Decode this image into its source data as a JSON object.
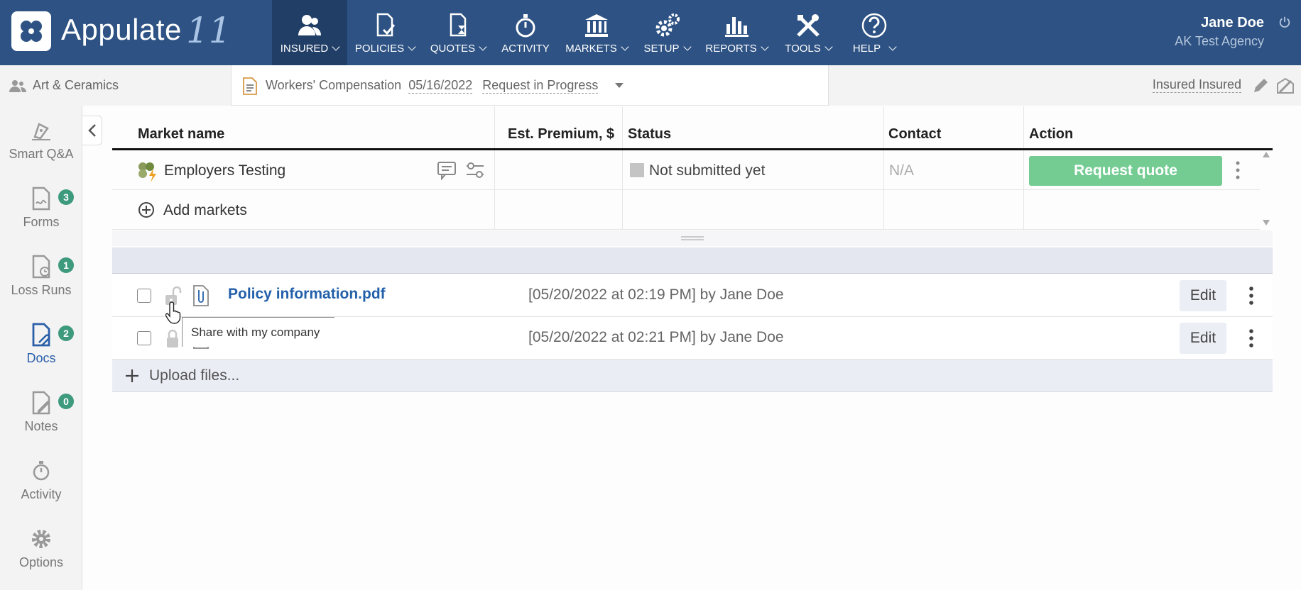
{
  "app": {
    "brand": "Appulate",
    "version_glyph": "11"
  },
  "nav": [
    {
      "label": "INSURED",
      "icon": "users-icon",
      "dropdown": true,
      "active": true
    },
    {
      "label": "POLICIES",
      "icon": "policy-check-icon",
      "dropdown": true
    },
    {
      "label": "QUOTES",
      "icon": "quote-hourglass-icon",
      "dropdown": true
    },
    {
      "label": "ACTIVITY",
      "icon": "stopwatch-icon",
      "dropdown": false
    },
    {
      "label": "MARKETS",
      "icon": "bank-icon",
      "dropdown": true
    },
    {
      "label": "SETUP",
      "icon": "gears-icon",
      "dropdown": true
    },
    {
      "label": "REPORTS",
      "icon": "bar-chart-icon",
      "dropdown": true
    },
    {
      "label": "TOOLS",
      "icon": "tools-icon",
      "dropdown": true
    },
    {
      "label": "HELP",
      "icon": "help-icon",
      "dropdown": true
    }
  ],
  "user": {
    "name": "Jane Doe",
    "agency": "AK Test Agency"
  },
  "subheader": {
    "insured": "Art & Ceramics",
    "policy_type": "Workers' Compensation",
    "date": "05/16/2022",
    "status": "Request in Progress",
    "right_label": "Insured Insured"
  },
  "sidebar": [
    {
      "label": "Smart Q&A",
      "icon": "pen-nib-icon",
      "badge": null
    },
    {
      "label": "Forms",
      "icon": "forms-icon",
      "badge": "3"
    },
    {
      "label": "Loss Runs",
      "icon": "loss-runs-icon",
      "badge": "1"
    },
    {
      "label": "Docs",
      "icon": "docs-icon",
      "badge": "2",
      "active": true
    },
    {
      "label": "Notes",
      "icon": "notes-icon",
      "badge": "0"
    },
    {
      "label": "Activity",
      "icon": "stopwatch-icon",
      "badge": null
    },
    {
      "label": "Options",
      "icon": "gear-icon",
      "badge": null
    }
  ],
  "markets": {
    "columns": [
      "Market name",
      "Est. Premium, $",
      "Status",
      "Contact",
      "Action"
    ],
    "rows": [
      {
        "name": "Employers Testing",
        "premium": "",
        "status": "Not submitted yet",
        "contact": "N/A",
        "action": "Request quote"
      }
    ],
    "add_label": "Add markets"
  },
  "docs": [
    {
      "name": "Policy information.pdf",
      "meta": "[05/20/2022 at 02:19 PM] by Jane Doe",
      "edit": "Edit"
    },
    {
      "name": "",
      "meta": "[05/20/2022 at 02:21 PM] by Jane Doe",
      "edit": "Edit"
    }
  ],
  "upload_label": "Upload files...",
  "tooltip": "Share with my company",
  "colors": {
    "nav_bg": "#2d5283",
    "accent_green": "#74cc93",
    "badge": "#3e9a7d",
    "link": "#2360aa"
  }
}
